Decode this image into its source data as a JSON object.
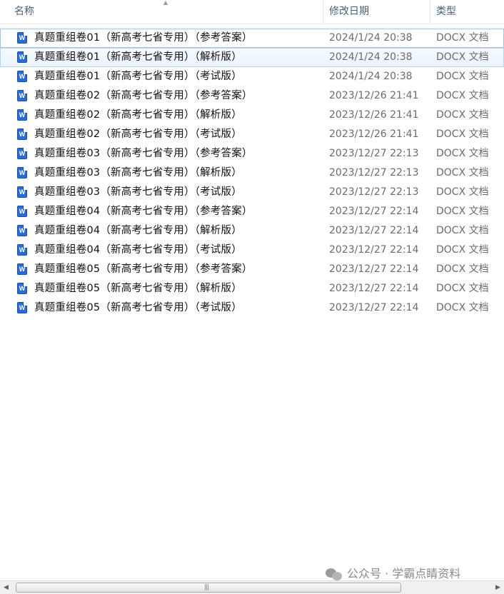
{
  "columns": {
    "name": "名称",
    "date": "修改日期",
    "type": "类型"
  },
  "files": [
    {
      "name": "真题重组卷01（新高考七省专用）（参考答案）",
      "date": "2024/1/24 20:38",
      "type": "DOCX 文档"
    },
    {
      "name": "真题重组卷01（新高考七省专用）（解析版）",
      "date": "2024/1/24 20:38",
      "type": "DOCX 文档"
    },
    {
      "name": "真题重组卷01（新高考七省专用）（考试版）",
      "date": "2024/1/24 20:38",
      "type": "DOCX 文档"
    },
    {
      "name": "真题重组卷02（新高考七省专用）（参考答案）",
      "date": "2023/12/26 21:41",
      "type": "DOCX 文档"
    },
    {
      "name": "真题重组卷02（新高考七省专用）（解析版）",
      "date": "2023/12/26 21:41",
      "type": "DOCX 文档"
    },
    {
      "name": "真题重组卷02（新高考七省专用）（考试版）",
      "date": "2023/12/26 21:41",
      "type": "DOCX 文档"
    },
    {
      "name": "真题重组卷03（新高考七省专用）（参考答案）",
      "date": "2023/12/27 22:13",
      "type": "DOCX 文档"
    },
    {
      "name": "真题重组卷03（新高考七省专用）（解析版）",
      "date": "2023/12/27 22:13",
      "type": "DOCX 文档"
    },
    {
      "name": "真题重组卷03（新高考七省专用）（考试版）",
      "date": "2023/12/27 22:13",
      "type": "DOCX 文档"
    },
    {
      "name": "真题重组卷04（新高考七省专用）（参考答案）",
      "date": "2023/12/27 22:14",
      "type": "DOCX 文档"
    },
    {
      "name": "真题重组卷04（新高考七省专用）（解析版）",
      "date": "2023/12/27 22:14",
      "type": "DOCX 文档"
    },
    {
      "name": "真题重组卷04（新高考七省专用）（考试版）",
      "date": "2023/12/27 22:14",
      "type": "DOCX 文档"
    },
    {
      "name": "真题重组卷05（新高考七省专用）（参考答案）",
      "date": "2023/12/27 22:14",
      "type": "DOCX 文档"
    },
    {
      "name": "真题重组卷05（新高考七省专用）（解析版）",
      "date": "2023/12/27 22:14",
      "type": "DOCX 文档"
    },
    {
      "name": "真题重组卷05（新高考七省专用）（考试版）",
      "date": "2023/12/27 22:14",
      "type": "DOCX 文档"
    }
  ],
  "file_icon": "word-document-icon",
  "file_icon_glyph": "W",
  "sort_icon": "sort-ascending-icon",
  "watermark": {
    "icon": "wechat-icon",
    "text": "公众号 · 学霸点睛资料"
  },
  "scrollbar": {
    "left_icon": "scroll-left-arrow-icon",
    "right_icon": "scroll-right-arrow-icon",
    "grip": "|||"
  },
  "colors": {
    "accent_icon": "#2a6bd6",
    "header_text": "#4c607a",
    "hover_border": "#bcd3ee"
  }
}
